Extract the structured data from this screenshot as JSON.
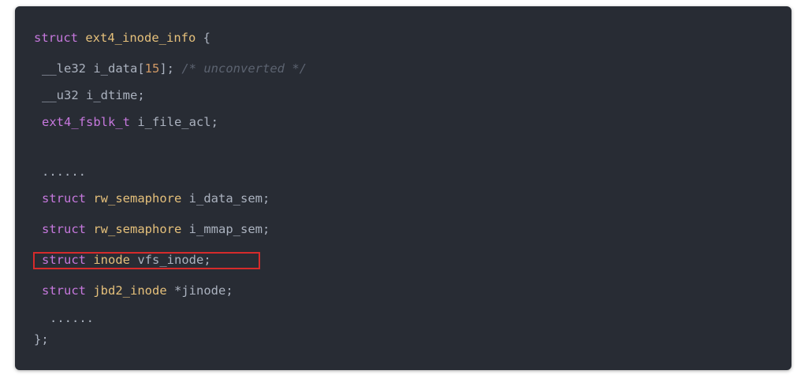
{
  "code": {
    "line1": {
      "kw": "struct",
      "name": "ext4_inode_info",
      "rest": " {"
    },
    "line2": {
      "type": "__le32",
      "rest": " i_data[",
      "num": "15",
      "rest2": "];",
      "comment": "/* unconverted */"
    },
    "line3": {
      "type": "__u32",
      "rest": " i_dtime;"
    },
    "line4": {
      "type": "ext4_fsblk_t",
      "rest": " i_file_acl;"
    },
    "line5": {
      "text": "......"
    },
    "line6": {
      "kw": "struct",
      "type": "rw_semaphore",
      "rest": " i_data_sem;"
    },
    "line7": {
      "kw": "struct",
      "type": "rw_semaphore",
      "rest": " i_mmap_sem;"
    },
    "line8": {
      "kw": "struct",
      "type": "inode",
      "rest": " vfs_inode;"
    },
    "line9": {
      "kw": "struct",
      "type": "jbd2_inode",
      "rest": " *jinode;"
    },
    "line10": {
      "text": "......"
    },
    "line11": {
      "text": "};"
    }
  },
  "colors": {
    "background": "#282c34",
    "keyword": "#c678dd",
    "type": "#e5c07b",
    "number": "#d19a66",
    "comment": "#5c6370",
    "highlight_border": "#d62b2b"
  }
}
